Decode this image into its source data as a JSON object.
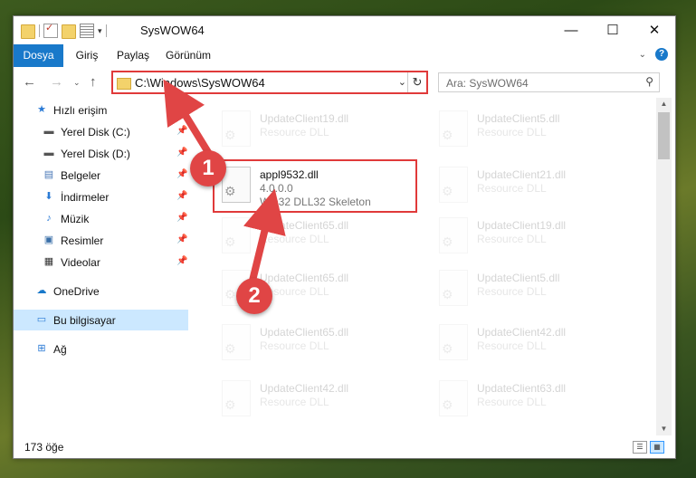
{
  "window": {
    "title": "SysWOW64",
    "controls": {
      "minimize": "—",
      "maximize": "☐",
      "close": "✕"
    }
  },
  "ribbon": {
    "tabs": [
      {
        "label": "Dosya",
        "active": true
      },
      {
        "label": "Giriş"
      },
      {
        "label": "Paylaş"
      },
      {
        "label": "Görünüm"
      }
    ],
    "help": "?"
  },
  "address": {
    "path": "C:\\Windows\\SysWOW64",
    "refresh": "↻"
  },
  "search": {
    "placeholder": "Ara: SysWOW64"
  },
  "navpane": {
    "quick_access": "Hızlı erişim",
    "items": [
      {
        "label": "Yerel Disk (C:)",
        "icon": "drive-icon",
        "pinned": true
      },
      {
        "label": "Yerel Disk (D:)",
        "icon": "drive-icon",
        "pinned": true
      },
      {
        "label": "Belgeler",
        "icon": "documents-icon",
        "pinned": true
      },
      {
        "label": "İndirmeler",
        "icon": "downloads-icon",
        "pinned": true
      },
      {
        "label": "Müzik",
        "icon": "music-icon",
        "pinned": true
      },
      {
        "label": "Resimler",
        "icon": "pictures-icon",
        "pinned": true
      },
      {
        "label": "Videolar",
        "icon": "videos-icon",
        "pinned": true
      }
    ],
    "onedrive": "OneDrive",
    "this_pc": "Bu bilgisayar",
    "network": "Ağ"
  },
  "files": [
    {
      "name": "UpdateClient19.dll",
      "desc": "Resource DLL",
      "faded": true
    },
    {
      "name": "UpdateClient5.dll",
      "desc": "Resource DLL",
      "faded": true
    },
    {
      "name": "appl9532.dll",
      "version": "4.0.0.0",
      "desc": "Win32 DLL32 Skeleton",
      "faded": false,
      "highlighted": true
    },
    {
      "name": "UpdateClient21.dll",
      "desc": "Resource DLL",
      "faded": true
    },
    {
      "name": "UpdateClient65.dll",
      "desc": "Resource DLL",
      "faded": true
    },
    {
      "name": "UpdateClient19.dll",
      "desc": "Resource DLL",
      "faded": true
    },
    {
      "name": "UpdateClient65.dll",
      "desc": "Resource DLL",
      "faded": true
    },
    {
      "name": "UpdateClient5.dll",
      "desc": "Resource DLL",
      "faded": true
    },
    {
      "name": "UpdateClient65.dll",
      "desc": "Resource DLL",
      "faded": true
    },
    {
      "name": "UpdateClient42.dll",
      "desc": "Resource DLL",
      "faded": true
    },
    {
      "name": "UpdateClient42.dll",
      "desc": "Resource DLL",
      "faded": true
    },
    {
      "name": "UpdateClient63.dll",
      "desc": "Resource DLL",
      "faded": true
    }
  ],
  "status": {
    "count": "173 öğe"
  },
  "annotations": {
    "step1": "1",
    "step2": "2",
    "color": "#e04545"
  }
}
